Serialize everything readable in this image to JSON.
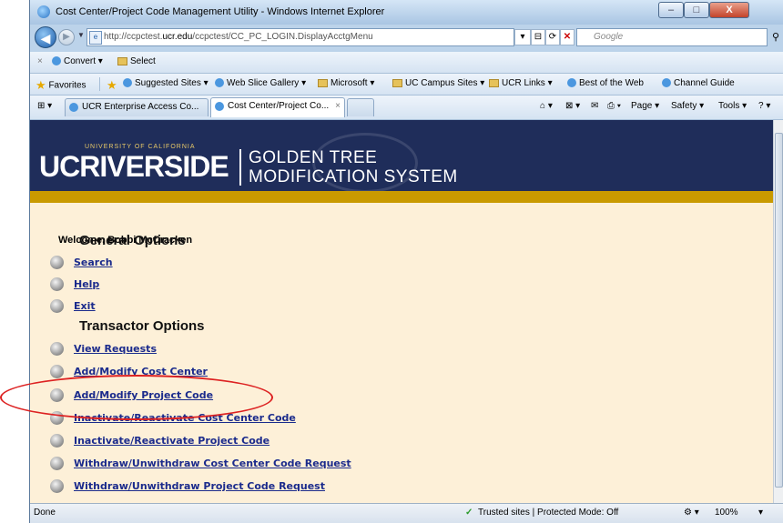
{
  "window": {
    "title": "Cost Center/Project Code Management Utility - Windows Internet Explorer",
    "buttons": {
      "minimize": "–",
      "maximize": "□",
      "close": "X"
    }
  },
  "address_bar": {
    "url_prefix": "http://ccpctest.",
    "url_host": "ucr.edu",
    "url_suffix": "/ccpctest/CC_PC_LOGIN.DisplayAcctgMenu",
    "search_placeholder": "Google"
  },
  "command_bar": {
    "convert": "Convert",
    "select": "Select"
  },
  "favorites_bar": {
    "favorites": "Favorites",
    "items": [
      {
        "label": "Suggested Sites ▾"
      },
      {
        "label": "Web Slice Gallery ▾"
      },
      {
        "label": "Microsoft ▾"
      },
      {
        "label": "UC Campus Sites ▾"
      },
      {
        "label": "UCR Links ▾"
      },
      {
        "label": "Best of the Web"
      },
      {
        "label": "Channel Guide"
      }
    ]
  },
  "tabs": [
    {
      "label": "UCR Enterprise Access Co..."
    },
    {
      "label": "Cost Center/Project Co..."
    }
  ],
  "tab_tools": {
    "page": "Page ▾",
    "safety": "Safety ▾",
    "tools": "Tools ▾"
  },
  "banner": {
    "uc": "UCRIVERSIDE",
    "univ_small": "UNIVERSITY OF CALIFORNIA",
    "line1": "GOLDEN TREE",
    "line2": "MODIFICATION SYSTEM"
  },
  "page": {
    "welcome": "Welcome, Bobbi McCracken",
    "general_title": "General Options",
    "general_options": [
      "Search",
      "Help",
      "Exit"
    ],
    "transactor_title": "Transactor Options",
    "transactor_options": [
      "View Requests",
      "Add/Modify Cost Center",
      "Add/Modify Project Code",
      "Inactivate/Reactivate Cost Center Code",
      "Inactivate/Reactivate Project Code",
      "Withdraw/Unwithdraw Cost Center Code Request",
      "Withdraw/Unwithdraw Project Code Request"
    ]
  },
  "status_bar": {
    "left": "Done",
    "zone": "Trusted sites | Protected Mode: Off",
    "zoom": "100%"
  },
  "colors": {
    "banner": "#1f2d5a",
    "gold": "#c99a00",
    "content_bg": "#fdf0d8",
    "link": "#1b2b8c",
    "annotation": "#dd2222"
  }
}
